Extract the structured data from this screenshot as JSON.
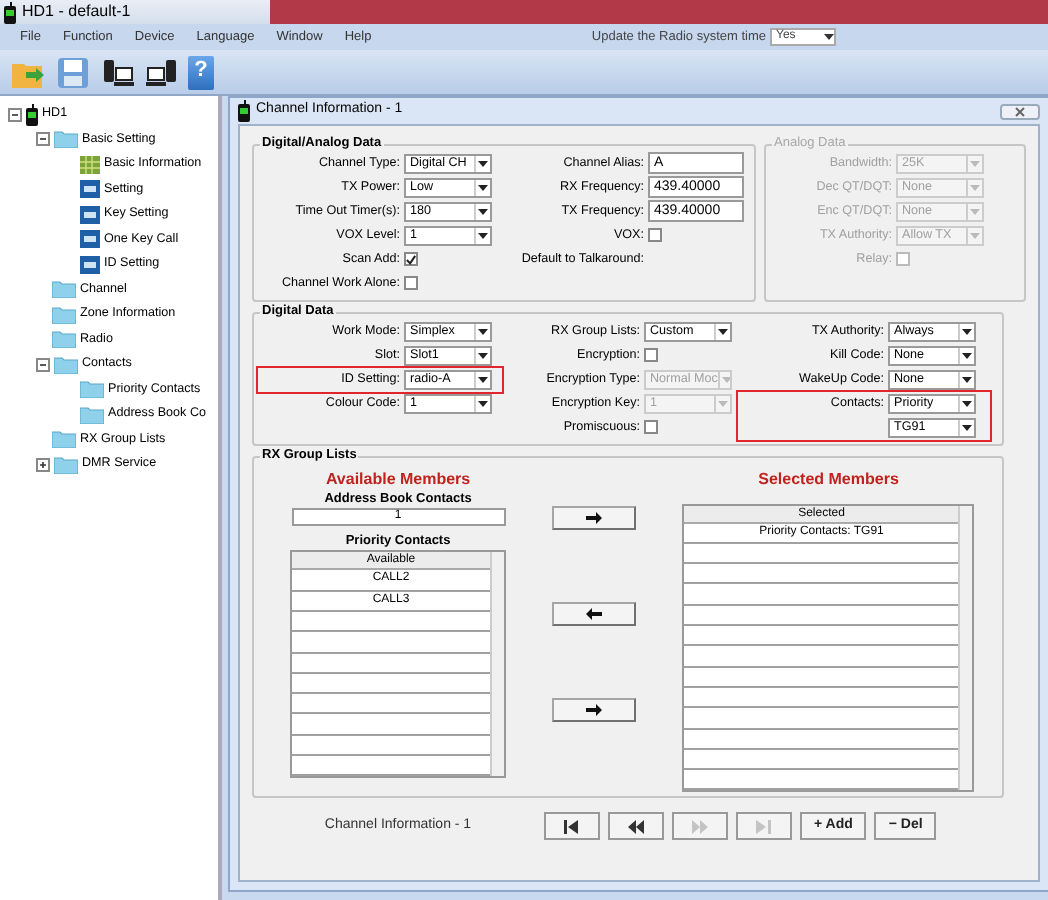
{
  "window": {
    "title": "HD1  -  default-1"
  },
  "menu": [
    "File",
    "Function",
    "Device",
    "Language",
    "Window",
    "Help"
  ],
  "time_update": {
    "label": "Update the Radio system time",
    "value": "Yes"
  },
  "toolbar": [
    {
      "kind": "open"
    },
    {
      "kind": "save"
    },
    {
      "kind": "read"
    },
    {
      "kind": "write"
    },
    {
      "kind": "help",
      "label": "?"
    }
  ],
  "tree": [
    {
      "label": "HD1",
      "kind": "radio",
      "expanded": true,
      "children": [
        {
          "label": "Basic Setting",
          "kind": "folder",
          "expanded": true,
          "children": [
            {
              "label": "Basic Information",
              "kind": "grid"
            },
            {
              "label": "Setting",
              "kind": "tile"
            },
            {
              "label": "Key Setting",
              "kind": "tile"
            },
            {
              "label": "One Key Call",
              "kind": "tile"
            },
            {
              "label": "ID Setting",
              "kind": "tile"
            }
          ]
        },
        {
          "label": "Channel",
          "kind": "folder"
        },
        {
          "label": "Zone Information",
          "kind": "folder"
        },
        {
          "label": "Radio",
          "kind": "folder"
        },
        {
          "label": "Contacts",
          "kind": "folder",
          "expanded": true,
          "children": [
            {
              "label": "Priority Contacts",
              "kind": "folder"
            },
            {
              "label": "Address Book Co",
              "kind": "folder"
            }
          ]
        },
        {
          "label": "RX Group Lists",
          "kind": "folder"
        },
        {
          "label": "DMR Service",
          "kind": "folder",
          "expanded": false
        }
      ]
    }
  ],
  "child_window": {
    "title": "Channel Information - 1"
  },
  "digital_analog": {
    "title": "Digital/Analog Data",
    "columns": [
      [
        {
          "label": "Channel Type:",
          "kind": "select",
          "value": "Digital CH"
        },
        {
          "label": "TX Power:",
          "kind": "select",
          "value": "Low"
        },
        {
          "label": "Time Out Timer(s):",
          "kind": "select",
          "value": "180"
        },
        {
          "label": "VOX Level:",
          "kind": "select",
          "value": "1"
        },
        {
          "label": "Scan Add:",
          "kind": "check",
          "checked": true
        },
        {
          "label": "Channel Work Alone:",
          "kind": "check",
          "checked": false
        }
      ],
      [
        {
          "label": "Channel Alias:",
          "kind": "text",
          "value": "A"
        },
        {
          "label": "RX Frequency:",
          "kind": "text",
          "value": "439.40000"
        },
        {
          "label": "TX Frequency:",
          "kind": "text",
          "value": "439.40000"
        },
        {
          "label": "VOX:",
          "kind": "check",
          "checked": false
        },
        {
          "label": "Default to Talkaround:",
          "kind": "none"
        }
      ]
    ]
  },
  "analog": {
    "title": "Analog Data",
    "disabled": true,
    "columns": [
      [
        {
          "label": "Bandwidth:",
          "kind": "select",
          "value": "25K"
        },
        {
          "label": "Dec QT/DQT:",
          "kind": "select",
          "value": "None"
        },
        {
          "label": "Enc QT/DQT:",
          "kind": "select",
          "value": "None"
        },
        {
          "label": "TX Authority:",
          "kind": "select",
          "value": "Allow TX"
        },
        {
          "label": "Relay:",
          "kind": "check",
          "checked": false
        }
      ]
    ]
  },
  "digital": {
    "title": "Digital Data",
    "columns": [
      [
        {
          "label": "Work Mode:",
          "kind": "select",
          "value": "Simplex"
        },
        {
          "label": "Slot:",
          "kind": "select",
          "value": "Slot1"
        },
        {
          "label": "ID Setting:",
          "kind": "select",
          "value": "radio-A",
          "highlighted": true
        },
        {
          "label": "Colour Code:",
          "kind": "select",
          "value": "1"
        }
      ],
      [
        {
          "label": "RX Group Lists:",
          "kind": "select",
          "value": "Custom"
        },
        {
          "label": "Encryption:",
          "kind": "check",
          "checked": false
        },
        {
          "label": "Encryption Type:",
          "kind": "select",
          "value": "Normal Moc",
          "disabled": true
        },
        {
          "label": "Encryption Key:",
          "kind": "select",
          "value": "1",
          "disabled": true
        },
        {
          "label": "Promiscuous:",
          "kind": "check",
          "checked": false
        }
      ],
      [
        {
          "label": "TX Authority:",
          "kind": "select",
          "value": "Always"
        },
        {
          "label": "Kill Code:",
          "kind": "select",
          "value": "None"
        },
        {
          "label": "WakeUp Code:",
          "kind": "select",
          "value": "None"
        },
        {
          "label": "Contacts:",
          "kind": "select",
          "value": "Priority",
          "highlighted": true
        },
        {
          "kind": "select",
          "value": "TG91",
          "highlighted": true
        }
      ]
    ]
  },
  "rx_group": {
    "title": "RX Group Lists",
    "available_title": "Available Members",
    "address_book_label": "Address Book Contacts",
    "address_book_value": "1",
    "priority_label": "Priority Contacts",
    "available_header": "Available",
    "available": [
      "CALL2",
      "CALL3"
    ],
    "buttons": [
      {
        "kind": "right"
      },
      {
        "kind": "left"
      },
      {
        "kind": "right"
      }
    ],
    "selected_title": "Selected Members",
    "selected_header": "Selected",
    "selected": [
      "Priority Contacts: TG91"
    ]
  },
  "footer": {
    "label": "Channel Information - 1",
    "nav": [
      {
        "kind": "first",
        "disabled": false
      },
      {
        "kind": "prev",
        "disabled": false
      },
      {
        "kind": "next",
        "disabled": true
      },
      {
        "kind": "last",
        "disabled": true
      }
    ],
    "buttons": [
      "+ Add",
      "− Del"
    ]
  }
}
